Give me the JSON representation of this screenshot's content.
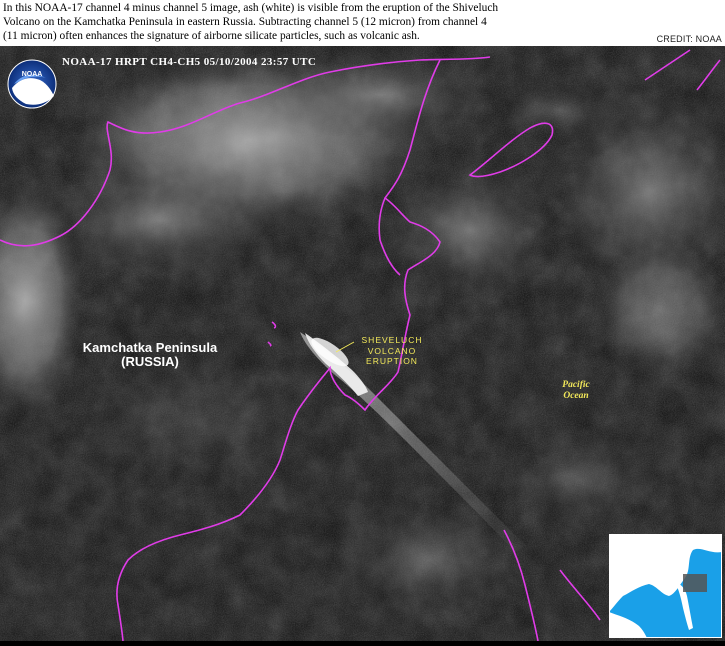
{
  "caption": {
    "line1": "In this NOAA-17 channel 4 minus channel 5 image, ash (white) is visible from the eruption of the Shiveluch",
    "line2": "Volcano on the Kamchatka Peninsula in eastern Russia.  Subtracting channel 5 (12 micron) from channel 4",
    "line3": "(11 micron) often enhances the signature of airborne silicate particles, such as volcanic ash."
  },
  "credit": "CREDIT: NOAA",
  "header": "NOAA-17  HRPT  CH4-CH5  05/10/2004  23:57 UTC",
  "logo_text": "NOAA",
  "labels": {
    "kamchatka": {
      "line1": "Kamchatka Peninsula",
      "line2": "(RUSSIA)"
    },
    "volcano": {
      "line1": "SHEVELUCH",
      "line2": "VOLCANO",
      "line3": "ERUPTION"
    },
    "ocean": {
      "line1": "Pacific",
      "line2": "Ocean"
    }
  },
  "colors": {
    "coastline": "#e03ce8",
    "label_yellow": "#f2e85a",
    "inset_water": "#1aa0e8",
    "inset_land": "#ffffff"
  }
}
